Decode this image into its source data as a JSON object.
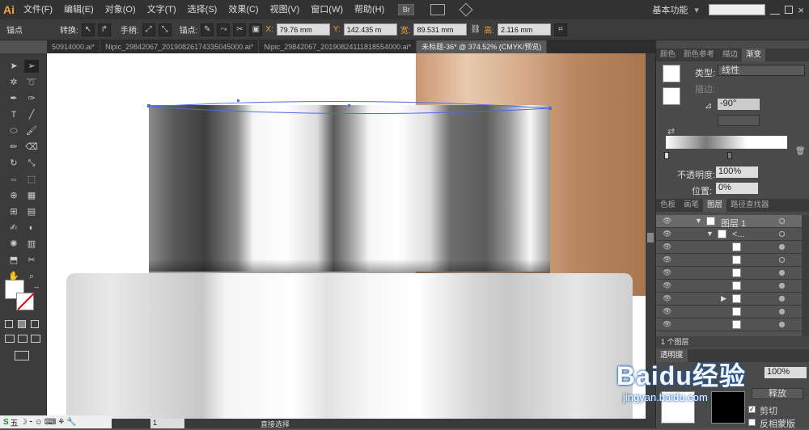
{
  "app": {
    "logo": "Ai"
  },
  "menu": [
    "文件(F)",
    "编辑(E)",
    "对象(O)",
    "文字(T)",
    "选择(S)",
    "效果(C)",
    "视图(V)",
    "窗口(W)",
    "帮助(H)"
  ],
  "workspace": "基本功能",
  "toolbar": {
    "anchor_label": "锚点",
    "convert_label": "转换:",
    "handle_label": "手柄:",
    "anchor2_label": "锚点:",
    "x_label": "X:",
    "x_value": "79.76 mm",
    "y_label": "Y:",
    "y_value": "142.435 m",
    "w_label": "宽:",
    "w_value": "89.531 mm",
    "h_label": "高:",
    "h_value": "2.116 mm"
  },
  "tabs": [
    {
      "label": "50914000.ai*",
      "active": false
    },
    {
      "label": "Nipic_29842067_20190826174335045000.ai*",
      "active": false
    },
    {
      "label": "Nipic_29842067_20190824111818554000.ai*",
      "active": false
    },
    {
      "label": "未标题-36* @ 374.52% (CMYK/预览)",
      "active": true
    }
  ],
  "gradient_panel": {
    "tabs": [
      "颜色",
      "颜色参考",
      "描边",
      "渐变"
    ],
    "type_label": "类型:",
    "type_value": "线性",
    "stroke_label": "描边:",
    "angle_value": "-90°",
    "opacity_label": "不透明度:",
    "opacity_value": "100%",
    "position_label": "位置:",
    "position_value": "0%"
  },
  "layers_panel": {
    "tabs": [
      "色板",
      "画笔",
      "图层",
      "路径查找器"
    ],
    "layer_name": "图层 1",
    "group_name": "<...",
    "footer_count": "1 个图层"
  },
  "transparency_panel": {
    "opacity_value": "100%",
    "release_label": "释放",
    "clip_label": "剪切",
    "invert_label": "反相蒙版"
  },
  "status": {
    "zoom_value": "1",
    "tool_name": "直接选择"
  },
  "watermark": {
    "text": "Baidu经验",
    "url": "jingyan.baidu.com"
  },
  "ime": [
    "五",
    "☽",
    "⁃",
    "☺",
    "⌨",
    "⚘",
    "🔧"
  ]
}
